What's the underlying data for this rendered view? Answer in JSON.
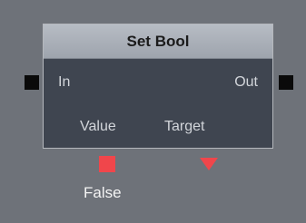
{
  "node": {
    "title": "Set Bool",
    "inputs": {
      "exec_in": "In",
      "value": "Value",
      "target": "Target"
    },
    "outputs": {
      "exec_out": "Out"
    },
    "value_display": "False"
  },
  "colors": {
    "background": "#6e7279",
    "node_body": "#3f4550",
    "node_header": "#aab0b8",
    "exec_port": "#0a0a0a",
    "data_port": "#f0464b"
  },
  "icons": {
    "value_port": "square-port",
    "target_port": "triangle-down-port"
  }
}
